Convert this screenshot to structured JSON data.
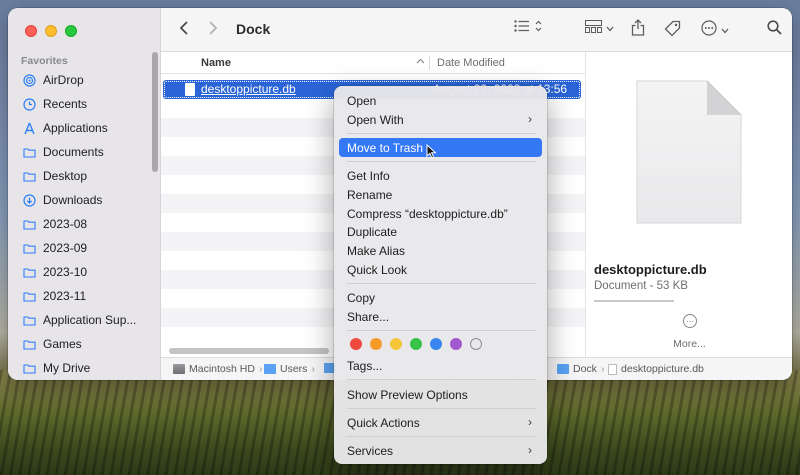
{
  "window": {
    "title": "Dock"
  },
  "sidebar": {
    "header": "Favorites",
    "items": [
      {
        "label": "AirDrop",
        "icon": "airdrop-icon"
      },
      {
        "label": "Recents",
        "icon": "clock-icon"
      },
      {
        "label": "Applications",
        "icon": "applications-icon"
      },
      {
        "label": "Documents",
        "icon": "folder-icon"
      },
      {
        "label": "Desktop",
        "icon": "folder-icon"
      },
      {
        "label": "Downloads",
        "icon": "download-icon"
      },
      {
        "label": "2023-08",
        "icon": "folder-icon"
      },
      {
        "label": "2023-09",
        "icon": "folder-icon"
      },
      {
        "label": "2023-10",
        "icon": "folder-icon"
      },
      {
        "label": "2023-11",
        "icon": "folder-icon"
      },
      {
        "label": "Application Sup...",
        "icon": "folder-icon"
      },
      {
        "label": "Games",
        "icon": "folder-icon"
      },
      {
        "label": "My Drive",
        "icon": "folder-icon"
      }
    ]
  },
  "list": {
    "col_name": "Name",
    "col_date": "Date Modified",
    "selected_file": {
      "name": "desktoppicture.db",
      "date": "August 22, 2023 at 13:56"
    }
  },
  "pathbar": {
    "items": [
      "Macintosh HD",
      "Users",
      "Dock",
      "desktoppicture.db"
    ]
  },
  "preview": {
    "name": "desktoppicture.db",
    "kind": "Document - 53 KB",
    "more_label": "More..."
  },
  "context_menu": {
    "open": "Open",
    "open_with": "Open With",
    "move_to_trash": "Move to Trash",
    "get_info": "Get Info",
    "rename": "Rename",
    "compress": "Compress “desktoppicture.db”",
    "duplicate": "Duplicate",
    "make_alias": "Make Alias",
    "quick_look": "Quick Look",
    "copy": "Copy",
    "share": "Share...",
    "tags": "Tags...",
    "show_preview_options": "Show Preview Options",
    "quick_actions": "Quick Actions",
    "services": "Services",
    "tag_colors": [
      "#ee4a3f",
      "#f59a2b",
      "#f5c53a",
      "#37c249",
      "#3a86f1",
      "#a35ad1"
    ]
  }
}
